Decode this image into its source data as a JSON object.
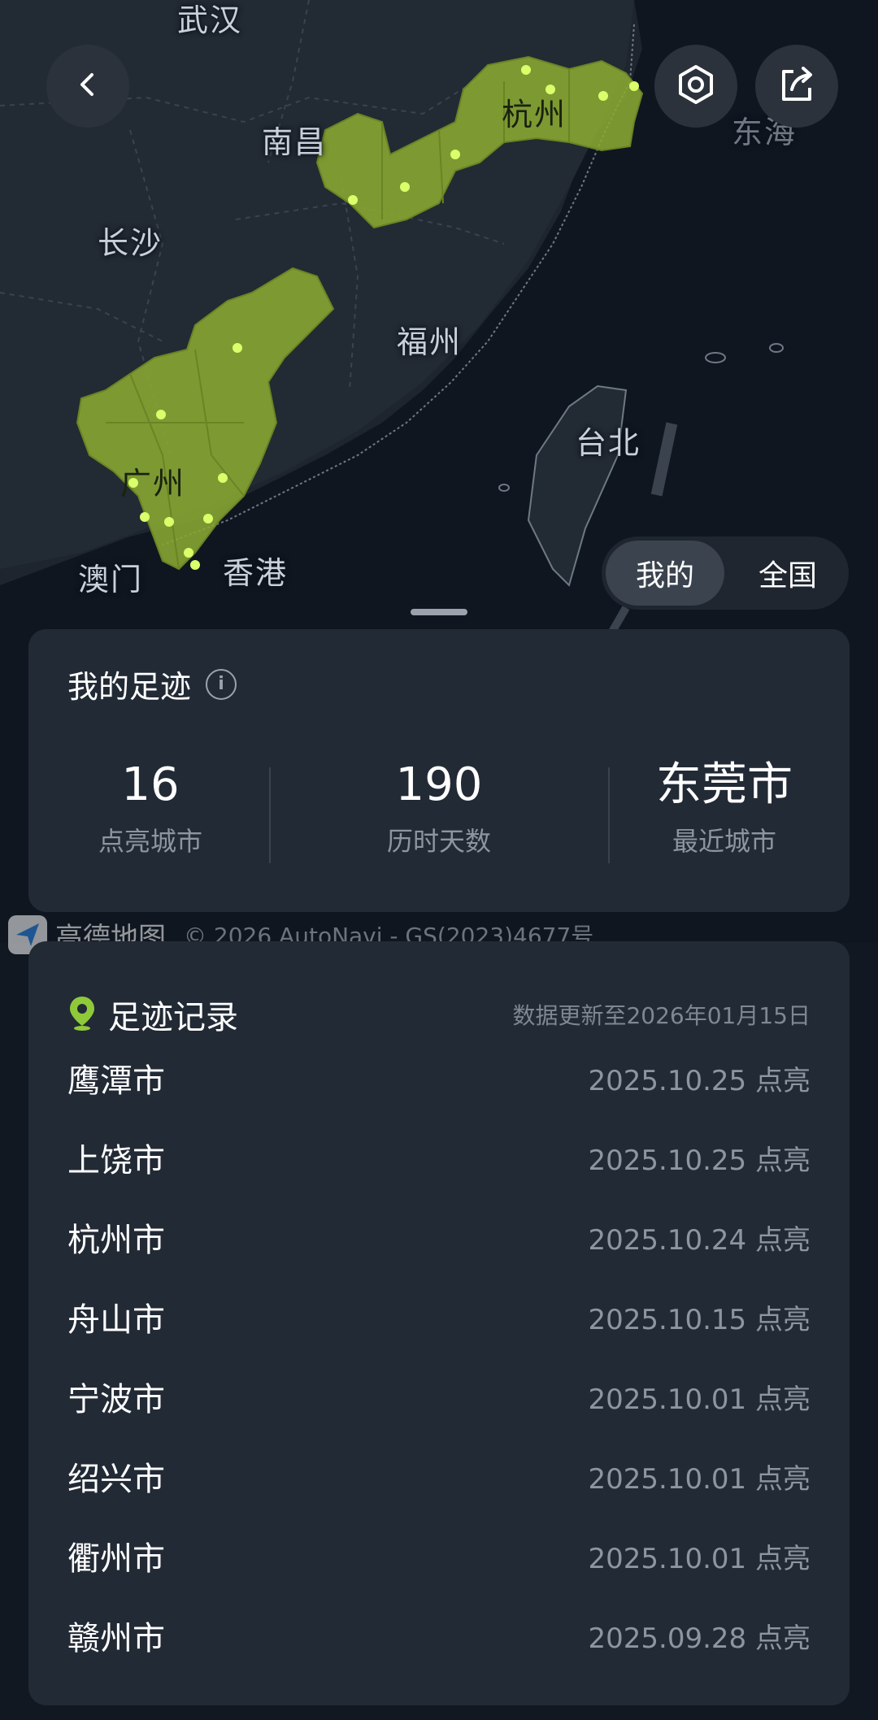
{
  "map": {
    "labels": {
      "wuhan": "武汉",
      "nanchang": "南昌",
      "hangzhou": "杭州",
      "donghai": "东海",
      "changsha": "长沙",
      "fuzhou": "福州",
      "taibei": "台北",
      "guangzhou": "广州",
      "aomen": "澳门",
      "xianggang": "香港"
    },
    "highlight_color": "#8aa832",
    "dot_color": "#d9ff6a"
  },
  "toggle": {
    "mine": "我的",
    "national": "全国",
    "active": "mine"
  },
  "stats": {
    "title": "我的足迹",
    "lit_cities": {
      "value": "16",
      "label": "点亮城市"
    },
    "days": {
      "value": "190",
      "label": "历时天数"
    },
    "recent": {
      "value": "东莞市",
      "label": "最近城市"
    }
  },
  "watermark": {
    "brand": "高德地图",
    "copyright": "© 2026 AutoNavi - GS(2023)4677号"
  },
  "records": {
    "title": "足迹记录",
    "updated": "数据更新至2026年01月15日",
    "items": [
      {
        "city": "鹰潭市",
        "date": "2025.10.25 点亮"
      },
      {
        "city": "上饶市",
        "date": "2025.10.25 点亮"
      },
      {
        "city": "杭州市",
        "date": "2025.10.24 点亮"
      },
      {
        "city": "舟山市",
        "date": "2025.10.15 点亮"
      },
      {
        "city": "宁波市",
        "date": "2025.10.01 点亮"
      },
      {
        "city": "绍兴市",
        "date": "2025.10.01 点亮"
      },
      {
        "city": "衢州市",
        "date": "2025.10.01 点亮"
      },
      {
        "city": "赣州市",
        "date": "2025.09.28 点亮"
      }
    ]
  },
  "icons": {
    "back": "chevron-left-icon",
    "settings": "settings-hexagon-icon",
    "share": "share-icon",
    "info": "info-icon",
    "location": "location-pin-icon"
  }
}
